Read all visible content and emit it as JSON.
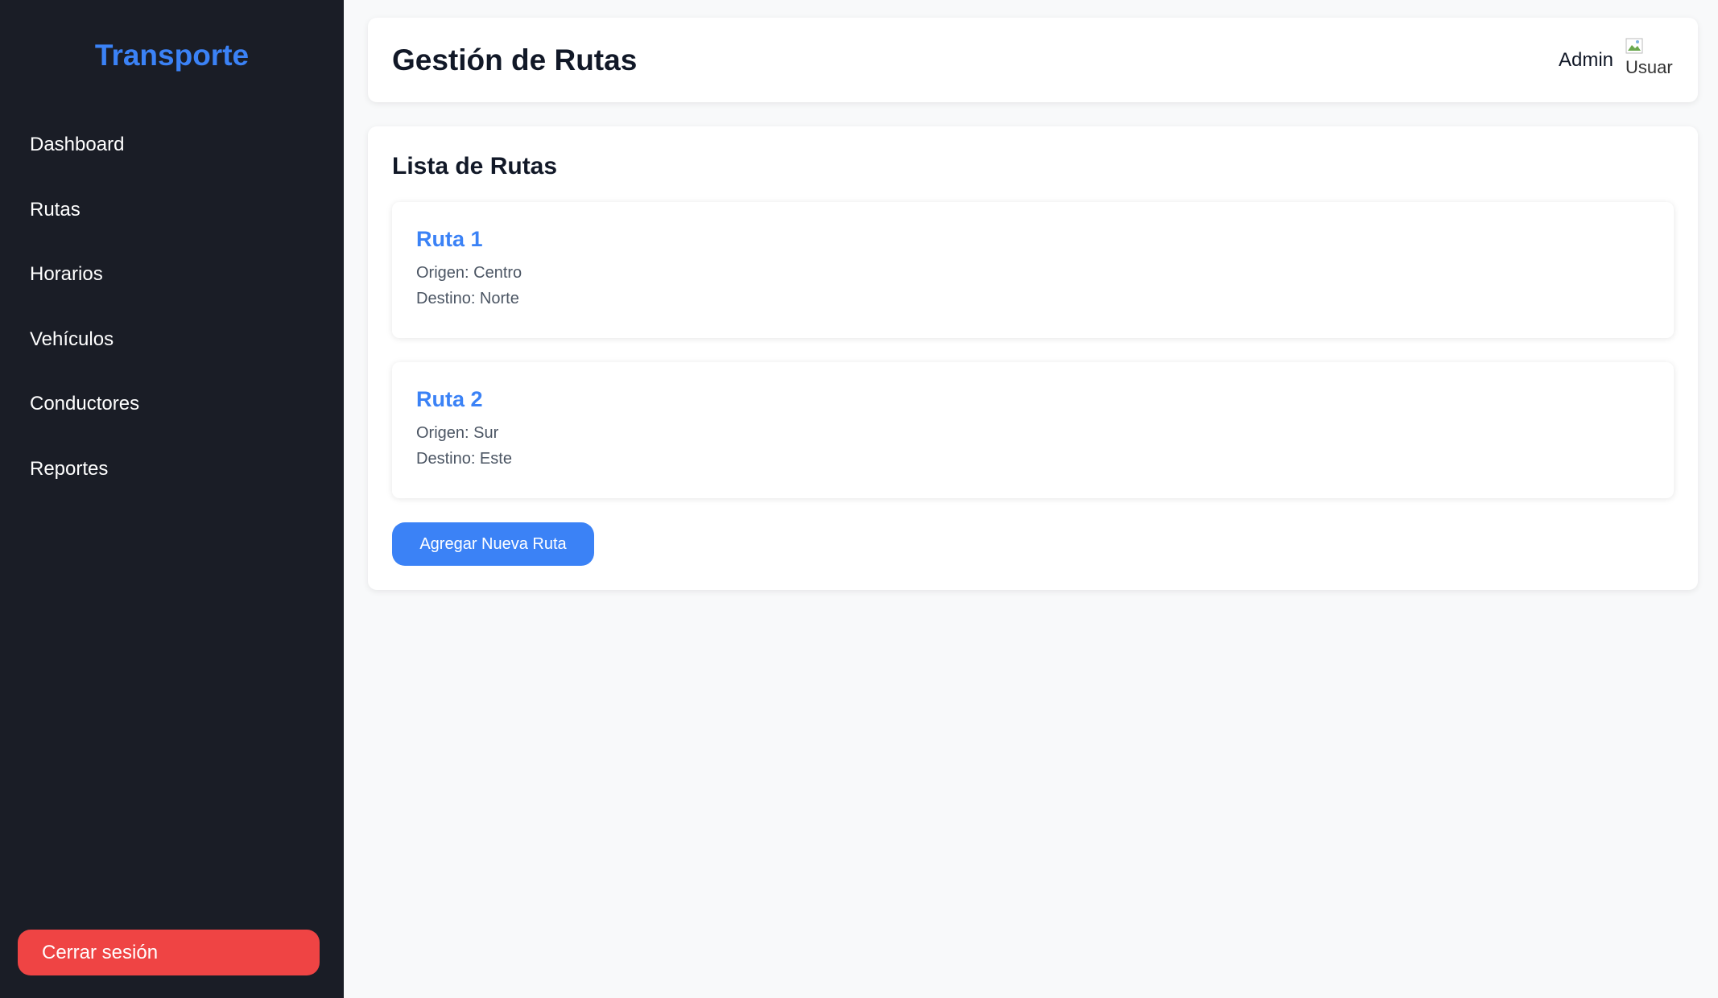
{
  "sidebar": {
    "brand": "Transporte",
    "items": [
      {
        "label": "Dashboard"
      },
      {
        "label": "Rutas"
      },
      {
        "label": "Horarios"
      },
      {
        "label": "Vehículos"
      },
      {
        "label": "Conductores"
      },
      {
        "label": "Reportes"
      }
    ],
    "logout_label": "Cerrar sesión"
  },
  "header": {
    "title": "Gestión de Rutas",
    "user_name": "Admin",
    "avatar_alt": "Usuario"
  },
  "routes_panel": {
    "title": "Lista de Rutas",
    "routes": [
      {
        "name": "Ruta 1",
        "origin": "Origen: Centro",
        "destination": "Destino: Norte"
      },
      {
        "name": "Ruta 2",
        "origin": "Origen: Sur",
        "destination": "Destino: Este"
      }
    ],
    "add_button_label": "Agregar Nueva Ruta"
  },
  "colors": {
    "sidebar_bg": "#1a1d26",
    "accent": "#3b82f6",
    "danger": "#ef4444",
    "page_bg": "#f8f9fa"
  }
}
